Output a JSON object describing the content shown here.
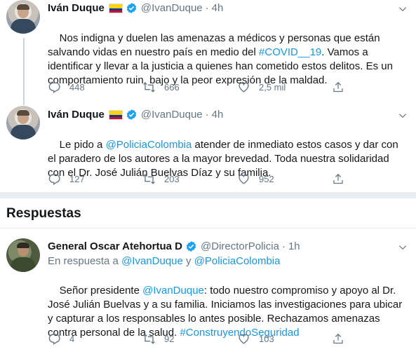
{
  "tweets": [
    {
      "name": "Iván Duque",
      "handle": "@IvanDuque",
      "separator": "·",
      "time": "4h",
      "text_parts": [
        {
          "t": "Nos indigna y duelen las amenazas a médicos y personas que están salvando vidas en nuestro país en medio del ",
          "link": false
        },
        {
          "t": "#COVID__19",
          "link": true
        },
        {
          "t": ". Vamos a identificar y llevar a la justicia a quienes han cometido estos delitos. Es un comportamiento ruin, bajo y la peor expresión de la maldad.",
          "link": false
        }
      ],
      "replies": "448",
      "retweets": "666",
      "likes": "2,5 mil"
    },
    {
      "name": "Iván Duque",
      "handle": "@IvanDuque",
      "separator": "·",
      "time": "4h",
      "text_parts": [
        {
          "t": "Le pido a ",
          "link": false
        },
        {
          "t": "@PoliciaColombia",
          "link": true
        },
        {
          "t": " atender de inmediato estos casos y dar con el paradero de los autores a la mayor brevedad. Toda nuestra solidaridad con el Dr. José Julián Buelvas Díaz y su familia.",
          "link": false
        }
      ],
      "replies": "127",
      "retweets": "203",
      "likes": "952"
    }
  ],
  "section_title": "Respuestas",
  "reply": {
    "name": "General Oscar Atehortua D",
    "handle": "@DirectorPolicia",
    "separator": "·",
    "time": "1h",
    "replying_prefix": "En respuesta a ",
    "replying_to_1": "@IvanDuque",
    "replying_join": " y ",
    "replying_to_2": "@PoliciaColombia",
    "text_parts": [
      {
        "t": "Señor presidente ",
        "link": false
      },
      {
        "t": "@IvanDuque",
        "link": true
      },
      {
        "t": ": todo nuestro compromiso y apoyo al Dr. José Julián Buelvas y a su familia. Iniciamos las investigaciones para ubicar y capturar a los responsables lo antes posible. Rechazamos amenazas contra personal de la salud. ",
        "link": false
      },
      {
        "t": "#ConstruyendoSeguridad",
        "link": true
      }
    ],
    "replies": "4",
    "retweets": "92",
    "likes": "103"
  },
  "colors": {
    "link": "#1b95e0",
    "secondary": "#657786",
    "verified": "#1da1f2",
    "divider": "#e6ecf0",
    "flag_yellow": "#fcd116",
    "flag_blue": "#003893",
    "flag_red": "#ce1126"
  },
  "icons": [
    "reply-icon",
    "retweet-icon",
    "like-icon",
    "share-icon",
    "verified-icon",
    "chevron-down-icon",
    "colombia-flag-icon"
  ]
}
